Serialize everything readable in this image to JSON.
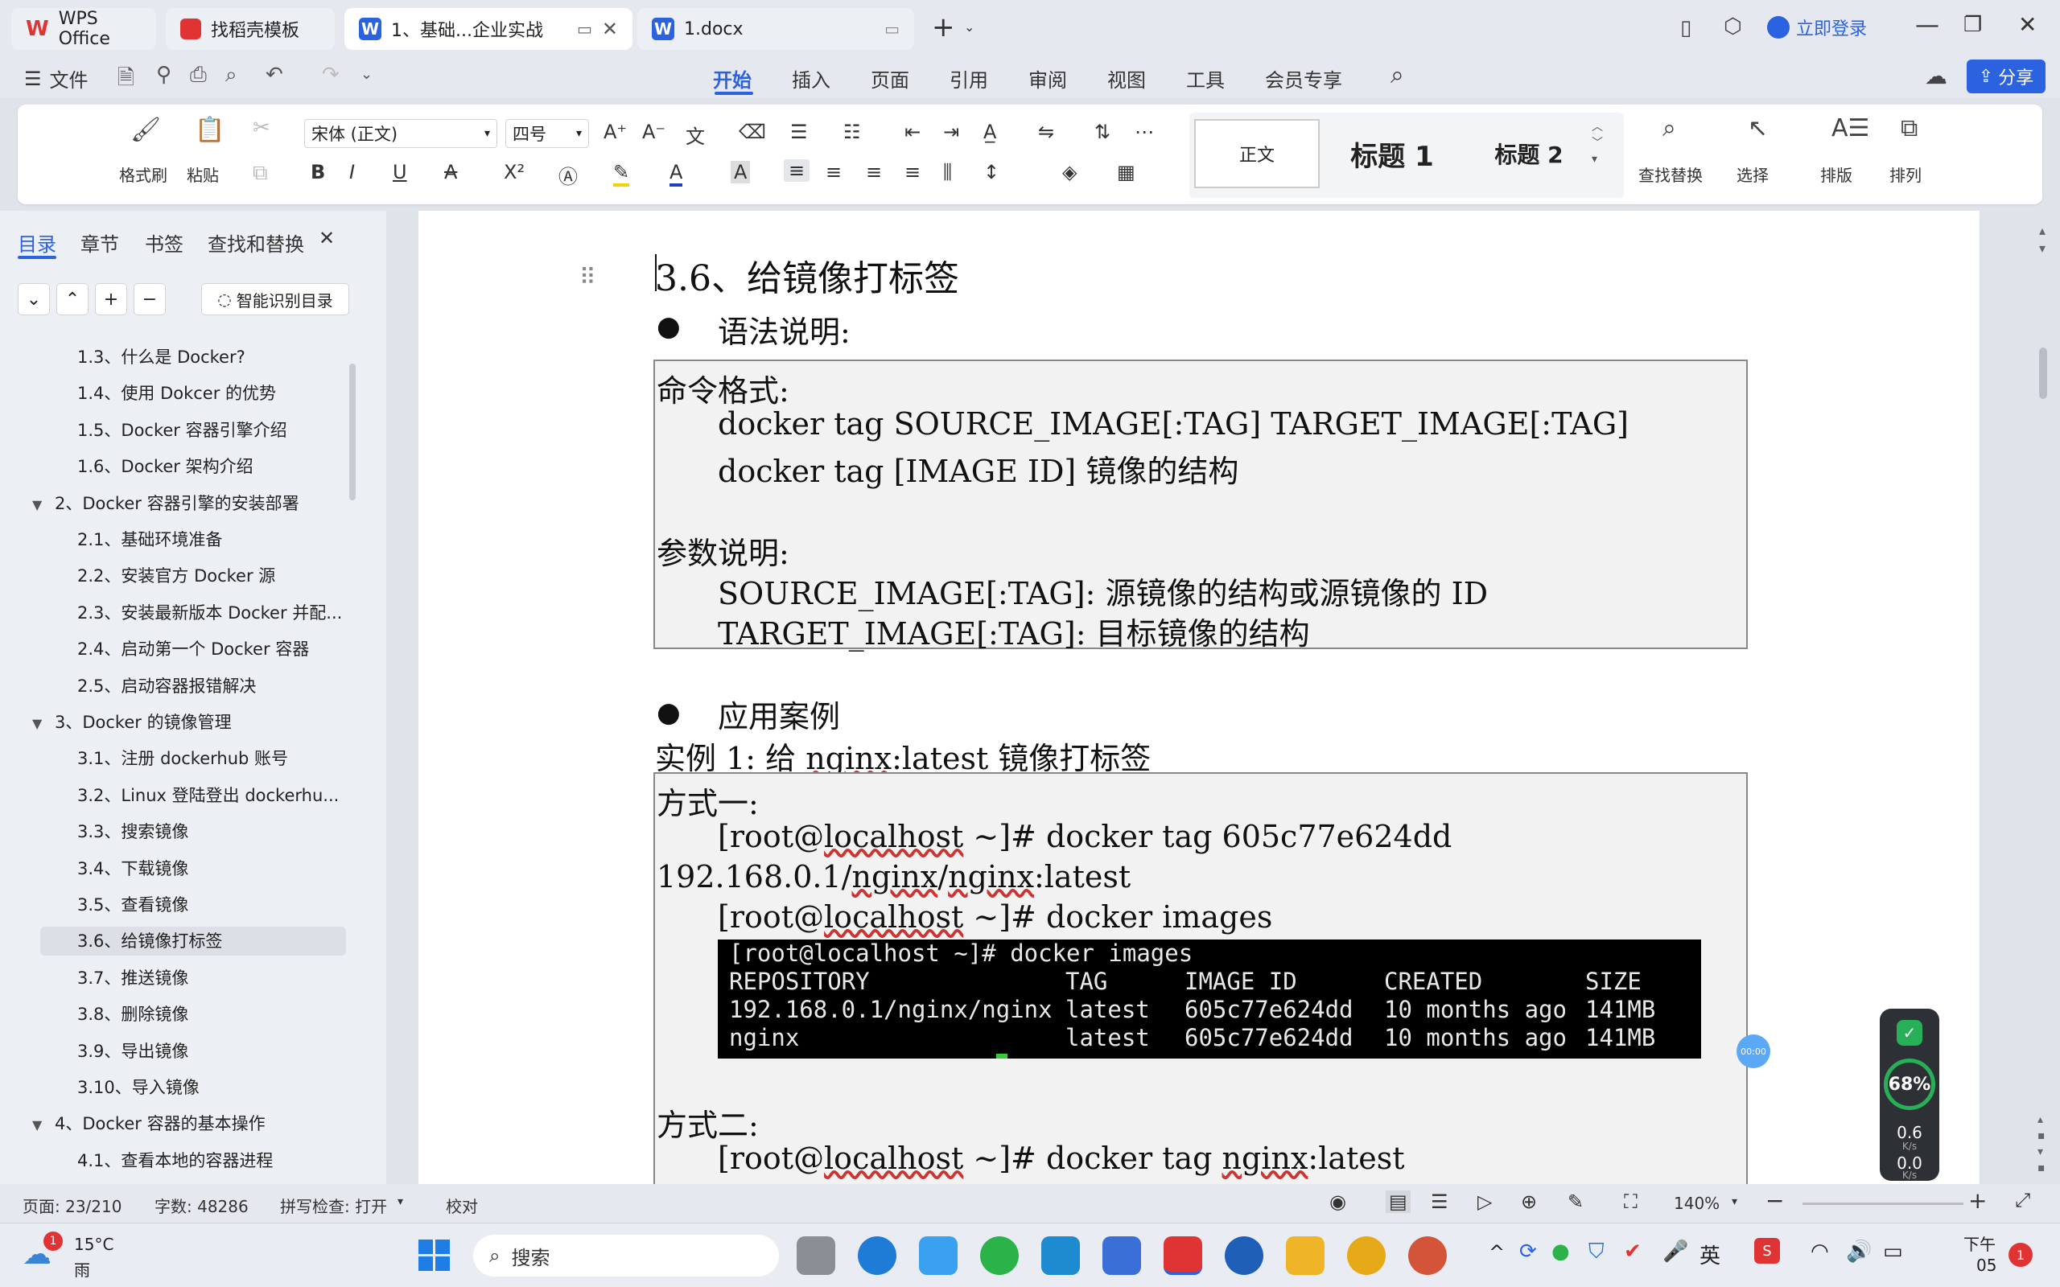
{
  "tabs": {
    "app": "WPS Office",
    "template": "找稻壳模板",
    "doc1": "1、基础...企业实战",
    "doc2": "1.docx",
    "login": "立即登录"
  },
  "menu": {
    "file": "文件",
    "items": [
      "开始",
      "插入",
      "页面",
      "引用",
      "审阅",
      "视图",
      "工具",
      "会员专享"
    ],
    "share": "分享"
  },
  "ribbon": {
    "format_painter": "格式刷",
    "paste": "粘贴",
    "font_name": "宋体 (正文)",
    "font_size": "四号",
    "style_normal": "正文",
    "style_h1": "标题 1",
    "style_h2": "标题 2",
    "find_replace": "查找替换",
    "select": "选择",
    "layout": "排版",
    "arrange": "排列"
  },
  "sidebar": {
    "tabs": [
      "目录",
      "章节",
      "书签",
      "查找和替换"
    ],
    "smart_toc": "智能识别目录",
    "items": [
      {
        "label": "1.3、什么是 Docker?",
        "level": 2
      },
      {
        "label": "1.4、使用 Dokcer 的优势",
        "level": 2
      },
      {
        "label": "1.5、Docker 容器引擎介绍",
        "level": 2
      },
      {
        "label": "1.6、Docker 架构介绍",
        "level": 2
      },
      {
        "label": "2、Docker 容器引擎的安装部署",
        "level": 1
      },
      {
        "label": "2.1、基础环境准备",
        "level": 2
      },
      {
        "label": "2.2、安装官方 Docker 源",
        "level": 2
      },
      {
        "label": "2.3、安装最新版本 Docker 并配...",
        "level": 2
      },
      {
        "label": "2.4、启动第一个 Docker 容器",
        "level": 2
      },
      {
        "label": "2.5、启动容器报错解决",
        "level": 2
      },
      {
        "label": "3、Docker 的镜像管理",
        "level": 1
      },
      {
        "label": "3.1、注册 dockerhub 账号",
        "level": 2
      },
      {
        "label": "3.2、Linux 登陆登出 dockerhu...",
        "level": 2
      },
      {
        "label": "3.3、搜索镜像",
        "level": 2
      },
      {
        "label": "3.4、下载镜像",
        "level": 2
      },
      {
        "label": "3.5、查看镜像",
        "level": 2
      },
      {
        "label": "3.6、给镜像打标签",
        "level": 2,
        "selected": true
      },
      {
        "label": "3.7、推送镜像",
        "level": 2
      },
      {
        "label": "3.8、删除镜像",
        "level": 2
      },
      {
        "label": "3.9、导出镜像",
        "level": 2
      },
      {
        "label": "3.10、导入镜像",
        "level": 2
      },
      {
        "label": "4、Docker 容器的基本操作",
        "level": 1
      },
      {
        "label": "4.1、查看本地的容器进程",
        "level": 2
      }
    ]
  },
  "doc": {
    "heading": "3.6、给镜像打标签",
    "bullet1": "语法说明:",
    "syntax_lines": [
      "命令格式:",
      "docker tag SOURCE_IMAGE[:TAG] TARGET_IMAGE[:TAG]",
      "docker tag [IMAGE ID] 镜像的结构",
      "参数说明:",
      "SOURCE_IMAGE[:TAG]: 源镜像的结构或源镜像的 ID",
      "TARGET_IMAGE[:TAG]: 目标镜像的结构"
    ],
    "bullet2": "应用案例",
    "example_title_pre": "实例 1: 给 ",
    "example_title_u": "nginx",
    "example_title_post": ":latest 镜像打标签",
    "way1": "方式一:",
    "cmd1_pre": "[root@",
    "cmd1_host": "localhost",
    "cmd1_post": " ~]# docker tag 605c77e624dd",
    "cmd1_cont_pre": "192.168.0.1/",
    "cmd1_cont_u1": "nginx",
    "cmd1_cont_mid": "/",
    "cmd1_cont_u2": "nginx",
    "cmd1_cont_post": ":latest",
    "cmd2_post": " ~]# docker images",
    "way2": "方式二:",
    "cmd3_post": " ~]# docker tag ",
    "cmd3_u": "nginx",
    "cmd3_tail": ":latest"
  },
  "terminal": {
    "prompt": "[root@localhost ~]# docker images",
    "headers": [
      "REPOSITORY",
      "TAG",
      "IMAGE ID",
      "CREATED",
      "SIZE"
    ],
    "rows": [
      [
        "192.168.0.1/nginx/nginx",
        "latest",
        "605c77e624dd",
        "10 months ago",
        "141MB"
      ],
      [
        "nginx",
        "latest",
        "605c77e624dd",
        "10 months ago",
        "141MB"
      ]
    ]
  },
  "status": {
    "page": "页面: 23/210",
    "words": "字数: 48286",
    "spell": "拼写检查: 打开",
    "proof": "校对",
    "zoom": "140%"
  },
  "netwidget": {
    "percent": "68%",
    "up": "0.6",
    "down": "0.0",
    "unit": "K/s"
  },
  "taskbar": {
    "weather_temp": "15°C",
    "weather_desc": "雨",
    "search": "搜索",
    "ime": "英",
    "clock_label": "下午",
    "clock_time": "05",
    "badge": "1",
    "timer": "00:00"
  },
  "colors": {
    "accent": "#2b62e0",
    "wps_red": "#e03434"
  }
}
